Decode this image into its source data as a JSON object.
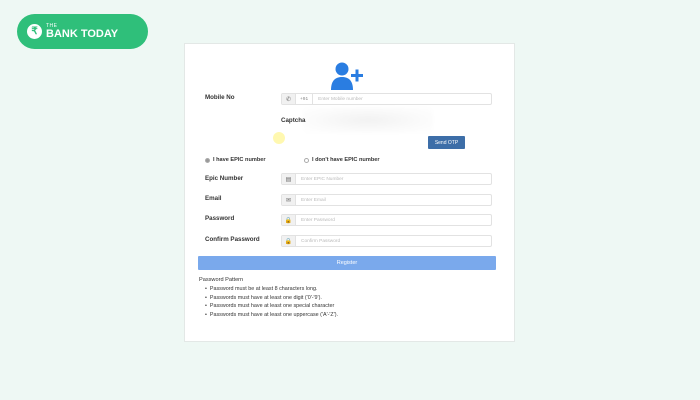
{
  "brand": {
    "logo_glyph": "₹",
    "small": "THE",
    "name": "BANK TODAY"
  },
  "form": {
    "avatar_icon": "user-plus-icon",
    "mobile": {
      "label": "Mobile No",
      "country_code": "+91",
      "placeholder": "Enter Mobile number"
    },
    "captcha": {
      "label": "Captcha"
    },
    "send_otp_label": "Send OTP",
    "epic_options": [
      {
        "label": "I have EPIC number",
        "selected": true
      },
      {
        "label": "I don't have EPIC number",
        "selected": false
      }
    ],
    "epic": {
      "label": "Epic Number",
      "placeholder": "Enter EPIC Number"
    },
    "email": {
      "label": "Email",
      "placeholder": "Enter Email"
    },
    "password": {
      "label": "Password",
      "placeholder": "Enter Password"
    },
    "confirm_password": {
      "label": "Confirm Password",
      "placeholder": "Confirm Password"
    },
    "register_label": "Register",
    "password_pattern": {
      "title": "Password Pattern",
      "rules": [
        "Password must be at least 8 characters long.",
        "Passwords must have at least one digit ('0'-'9').",
        "Passwords must have at least one special character",
        "Passwords must have at least one uppercase ('A'-'Z')."
      ]
    }
  },
  "colors": {
    "brand_green": "#2fbf7a",
    "avatar_blue": "#2a7de1",
    "otp_button": "#3d6ea8",
    "register_button": "#7aa9ec"
  }
}
